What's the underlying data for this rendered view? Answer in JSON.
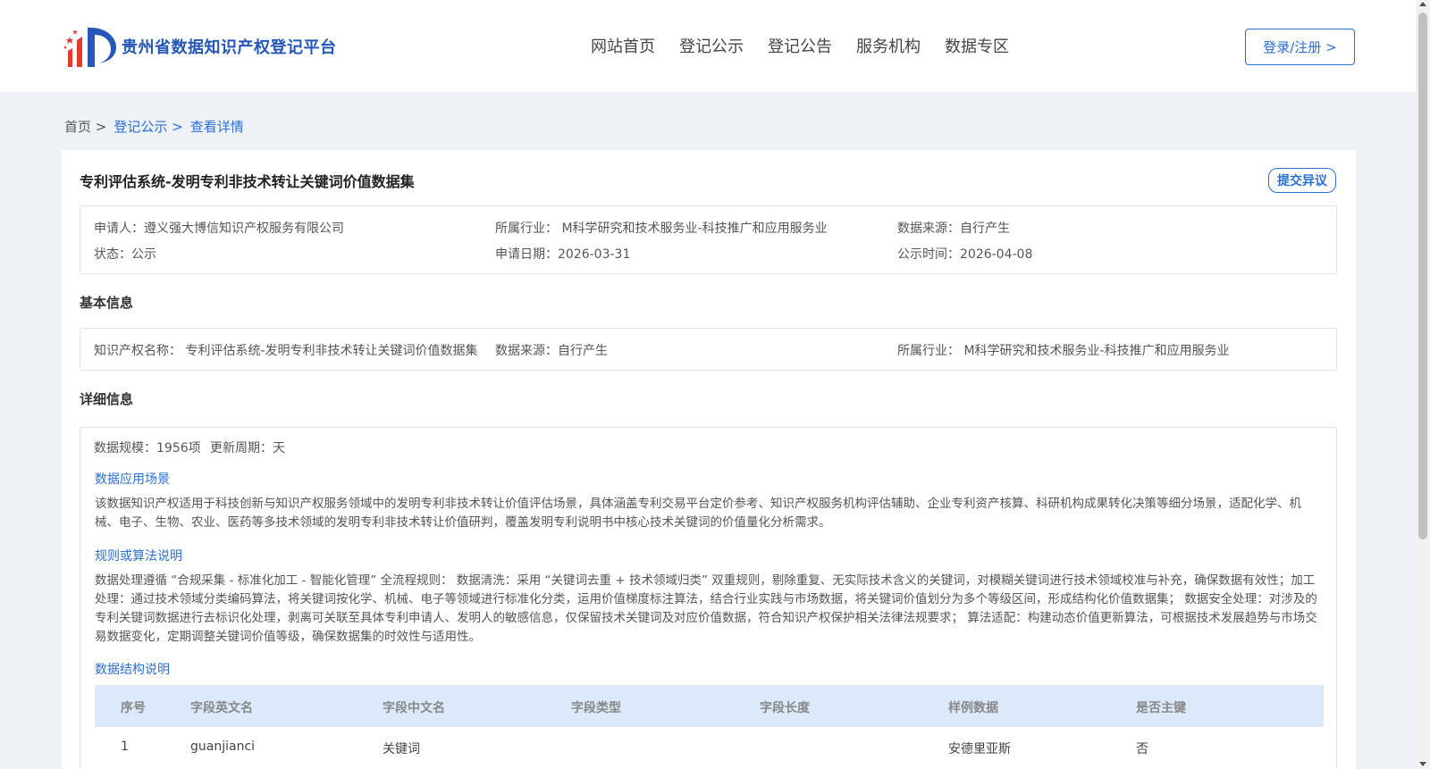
{
  "header": {
    "logo_text": "贵州省数据知识产权登记平台",
    "nav": [
      "网站首页",
      "登记公示",
      "登记公告",
      "服务机构",
      "数据专区"
    ],
    "login_label": "登录/注册 >"
  },
  "breadcrumb": {
    "home": "首页 >",
    "level1": "登记公示 >",
    "current": "查看详情"
  },
  "record": {
    "title": "专利评估系统-发明专利非技术转让关键词价值数据集",
    "objection_label": "提交异议",
    "summary": {
      "applicant": "申请人：遵义强大博信知识产权服务有限公司",
      "industry": "所属行业： M科学研究和技术服务业-科技推广和应用服务业",
      "source": "数据来源：自行产生",
      "status": "状态：公示",
      "apply_date": "申请日期：2026-03-31",
      "publish_time": "公示时间：2026-04-08"
    }
  },
  "basic": {
    "section_title": "基本信息",
    "ip_name": "知识产权名称： 专利评估系统-发明专利非技术转让关键词价值数据集",
    "source": "数据来源：自行产生",
    "industry": "所属行业： M科学研究和技术服务业-科技推广和应用服务业"
  },
  "detail": {
    "section_title": "详细信息",
    "scale": "数据规模：1956项",
    "update_cycle": "更新周期：天",
    "scenario_title": "数据应用场景",
    "scenario_text": "该数据知识产权适用于科技创新与知识产权服务领域中的发明专利非技术转让价值评估场景，具体涵盖专利交易平台定价参考、知识产权服务机构评估辅助、企业专利资产核算、科研机构成果转化决策等细分场景，适配化学、机械、电子、生物、农业、医药等多技术领域的发明专利非技术转让价值研判，覆盖发明专利说明书中核心技术关键词的价值量化分析需求。",
    "rules_title": "规则或算法说明",
    "rules_text": "数据处理遵循 “合规采集 - 标准化加工 - 智能化管理” 全流程规则： 数据清洗：采用 “关键词去重 + 技术领域归类” 双重规则，剔除重复、无实际技术含义的关键词，对模糊关键词进行技术领域校准与补充，确保数据有效性；加工处理：通过技术领域分类编码算法，将关键词按化学、机械、电子等领域进行标准化分类，运用价值梯度标注算法，结合行业实践与市场数据，将关键词价值划分为多个等级区间，形成结构化价值数据集； 数据安全处理：对涉及的专利关键词数据进行去标识化处理，剥离可关联至具体专利申请人、发明人的敏感信息，仅保留技术关键词及对应价值数据，符合知识产权保护相关法律法规要求； 算法适配：构建动态价值更新算法，可根据技术发展趋势与市场交易数据变化，定期调整关键词价值等级，确保数据集的时效性与适用性。",
    "structure_title": "数据结构说明",
    "table": {
      "headers": [
        "序号",
        "字段英文名",
        "字段中文名",
        "字段类型",
        "字段长度",
        "样例数据",
        "是否主键"
      ],
      "rows": [
        [
          "1",
          "guanjianci",
          "关键词",
          "",
          "",
          "安德里亚斯",
          "否"
        ]
      ]
    }
  },
  "colors": {
    "primary": "#2a6fd6",
    "logo_blue": "#2557b8",
    "logo_red": "#e23a2c",
    "table_header_bg": "#dbe9fb",
    "page_bg": "#eef2f6"
  }
}
